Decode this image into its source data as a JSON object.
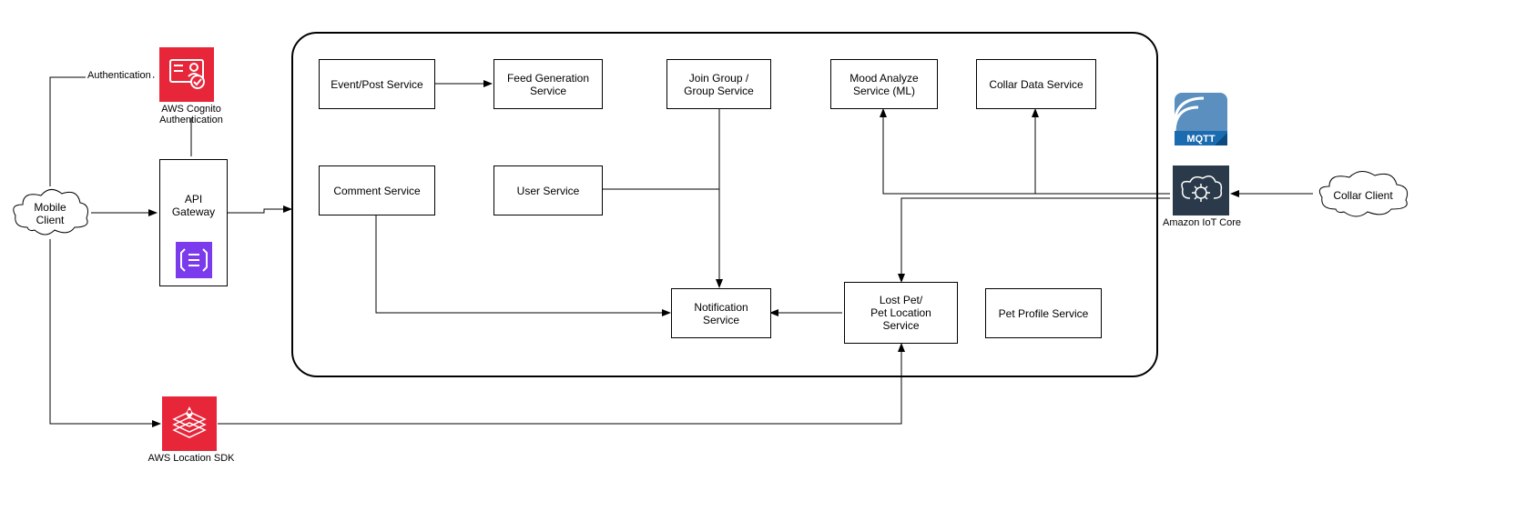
{
  "nodes": {
    "mobile_client": "Mobile\nClient",
    "collar_client": "Collar Client",
    "cognito": "AWS Cognito\nAuthentication",
    "api_gateway": "API\nGateway",
    "location_sdk": "AWS Location SDK",
    "iot_core": "Amazon IoT\nCore",
    "mqtt": "MQTT",
    "event_post": "Event/Post Service",
    "feed_gen": "Feed Generation\nService",
    "join_group": "Join Group /\nGroup Service",
    "mood": "Mood Analyze\nService (ML)",
    "collar_data": "Collar Data Service",
    "comment": "Comment Service",
    "user": "User Service",
    "notification": "Notification Service",
    "lost_pet": "Lost Pet/\nPet Location\nService",
    "pet_profile": "Pet Profile Service"
  },
  "edges": {
    "authentication": "Authentication"
  }
}
